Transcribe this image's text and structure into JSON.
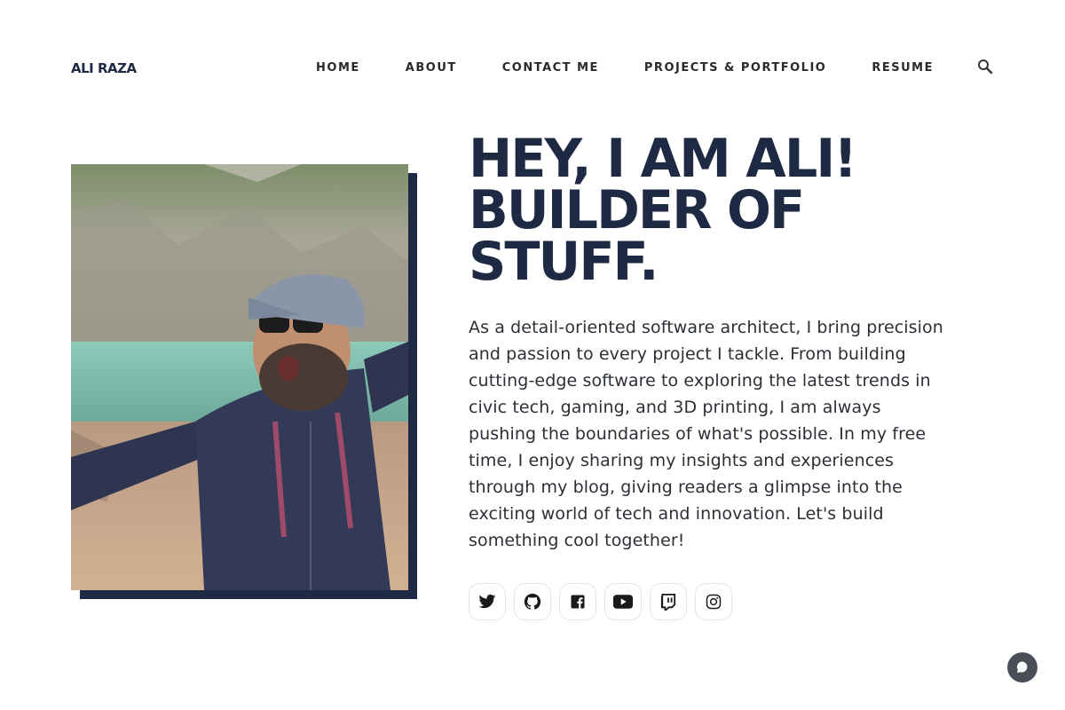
{
  "site": {
    "logo": "ALI RAZA"
  },
  "nav": {
    "items": [
      "HOME",
      "ABOUT",
      "CONTACT ME",
      "PROJECTS & PORTFOLIO",
      "RESUME"
    ],
    "search_icon": "search-icon"
  },
  "hero": {
    "title_lines": [
      "HEY, I AM ALI!",
      "BUILDER OF",
      "STUFF."
    ],
    "bio": "As a detail-oriented software architect, I bring precision and passion to every project I tackle. From building cutting-edge software to exploring the latest trends in civic tech, gaming, and 3D printing, I am always pushing the boundaries of what's possible. In my free time, I enjoy sharing my insights and experiences through my blog, giving readers a glimpse into the exciting world of tech and innovation. Let's build something cool together!",
    "photo_icon": "profile-photo"
  },
  "socials": [
    "twitter-icon",
    "github-icon",
    "facebook-icon",
    "youtube-icon",
    "twitch-icon",
    "instagram-icon"
  ],
  "chat": {
    "icon": "chat-bubble-icon"
  },
  "colors": {
    "navy": "#1e2a44",
    "text": "#2b2f36",
    "border": "#e4e6ea",
    "chat_bg": "#4a4f57"
  }
}
